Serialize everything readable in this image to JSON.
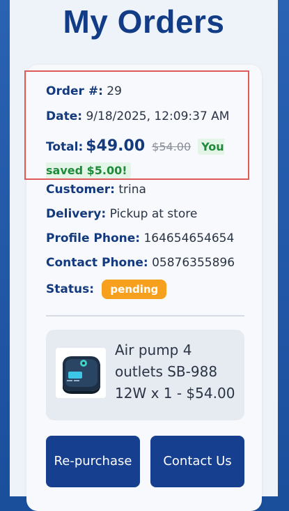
{
  "page": {
    "title": "My Orders"
  },
  "order": {
    "number_label": "Order #:",
    "number": "29",
    "date_label": "Date:",
    "date": "9/18/2025, 12:09:37 AM",
    "total_label": "Total:",
    "total": "$49.00",
    "original_total": "$54.00",
    "savings": "You saved $5.00!",
    "customer_label": "Customer:",
    "customer": "trina",
    "delivery_label": "Delivery:",
    "delivery": "Pickup at store",
    "profile_phone_label": "Profile Phone:",
    "profile_phone": "164654654654",
    "contact_phone_label": "Contact Phone:",
    "contact_phone": "05876355896",
    "status_label": "Status:",
    "status": "pending",
    "status_color": "#f7a01e"
  },
  "items": [
    {
      "line": "Air pump 4 outlets SB-988 12W x 1 - $54.00",
      "icon": "air-pump-image"
    }
  ],
  "actions": {
    "repurchase": "Re-purchase",
    "contact": "Contact Us"
  },
  "colors": {
    "primary": "#173f8f",
    "accent_highlight": "#e05a5a",
    "savings_green": "#1e8a3a"
  }
}
